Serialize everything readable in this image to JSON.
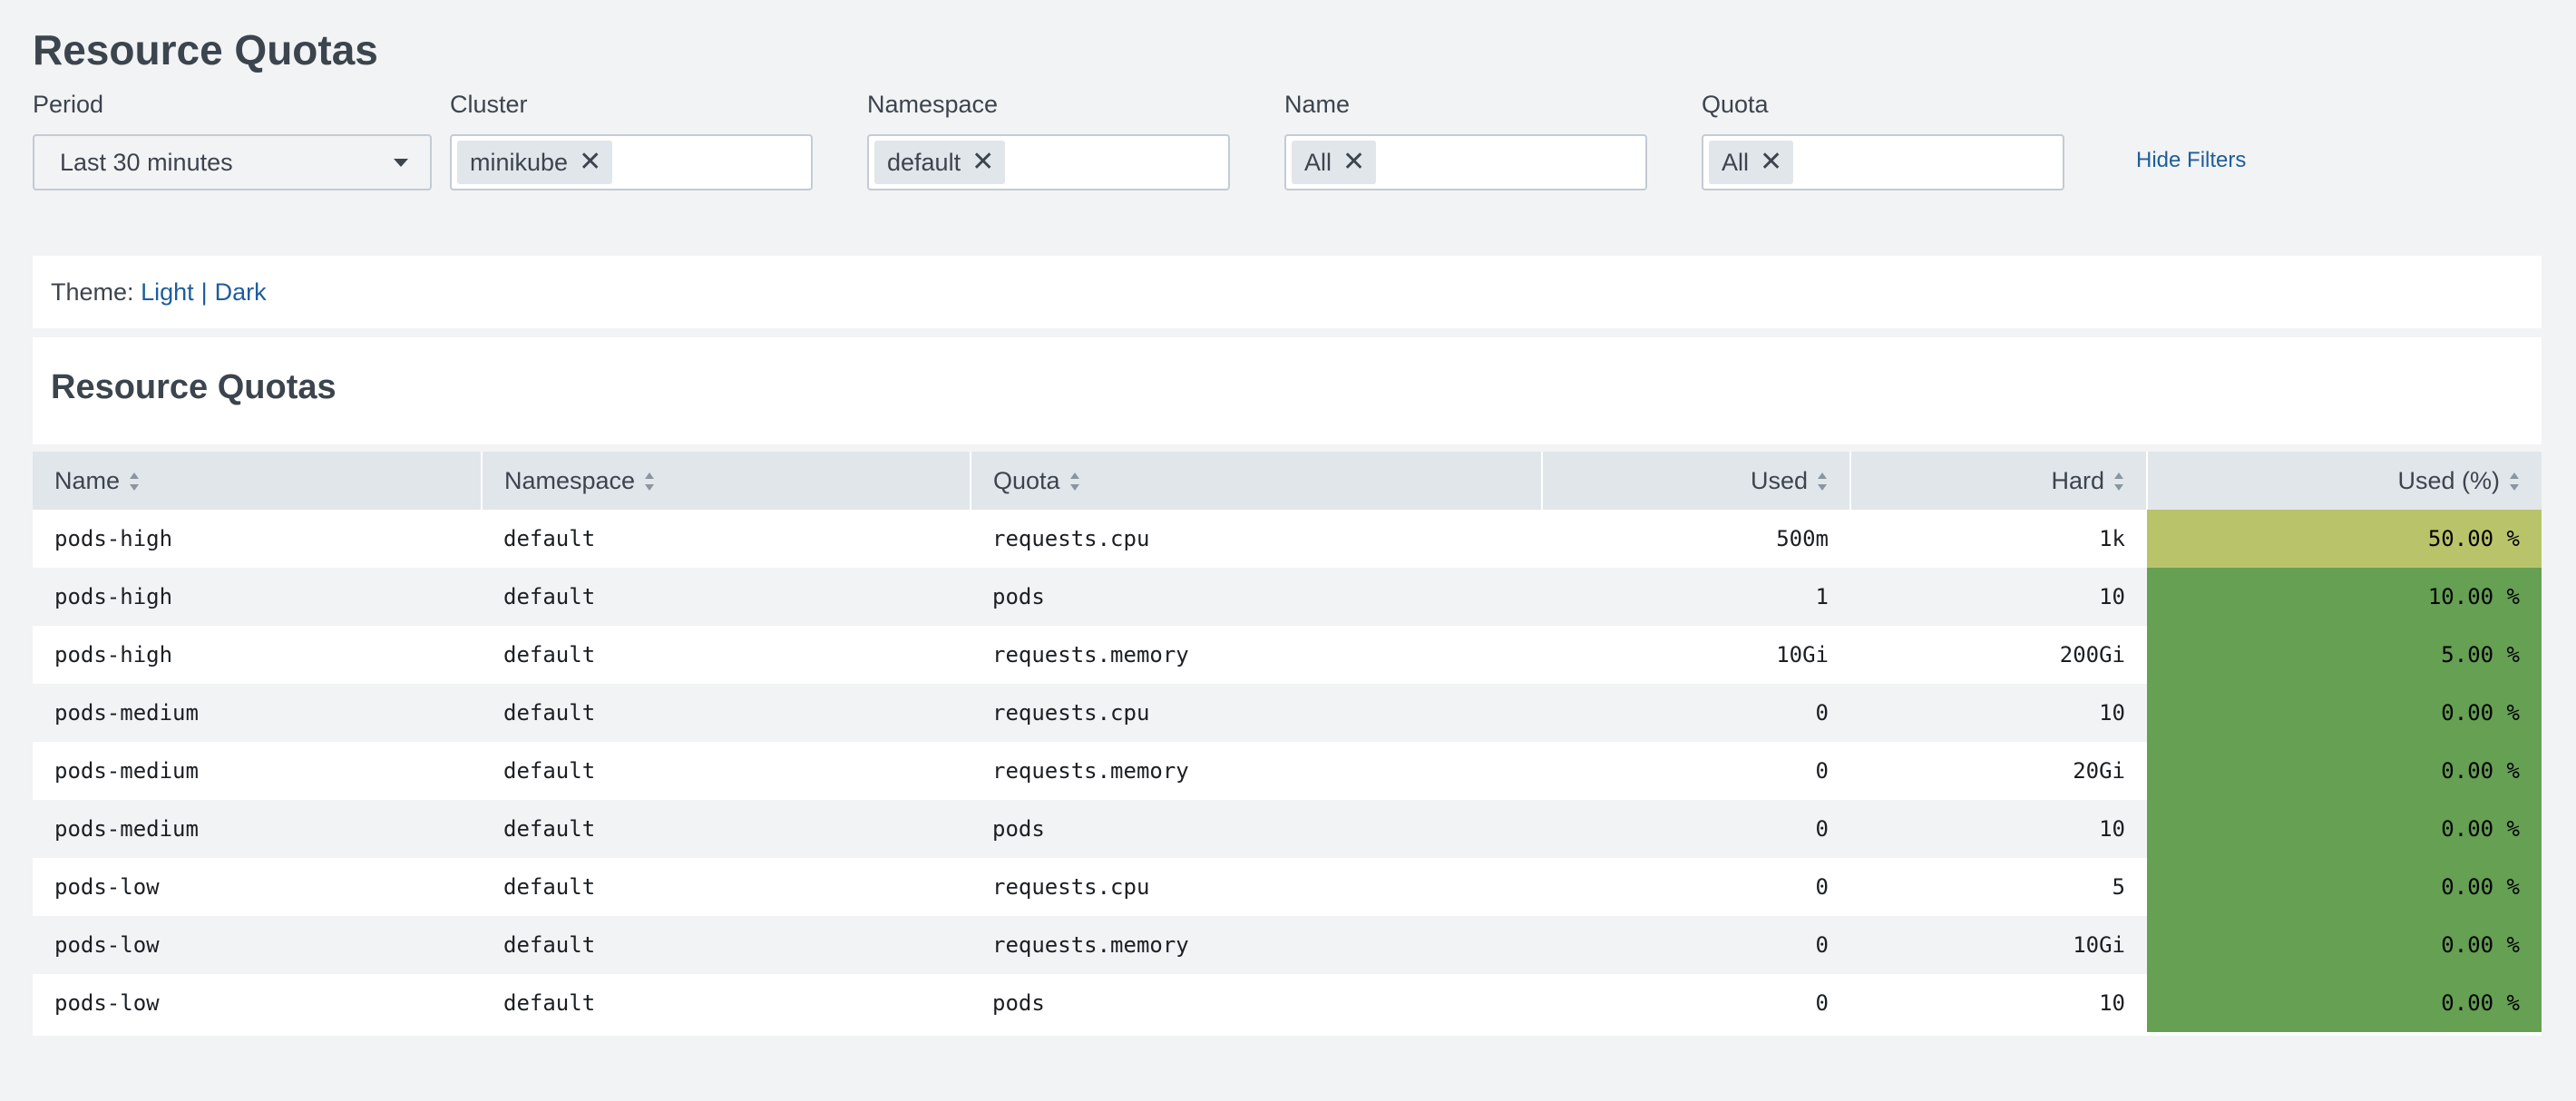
{
  "page": {
    "title": "Resource Quotas"
  },
  "filters": {
    "period": {
      "label": "Period",
      "value": "Last 30 minutes"
    },
    "cluster": {
      "label": "Cluster",
      "tokens": [
        "minikube"
      ]
    },
    "namespace": {
      "label": "Namespace",
      "tokens": [
        "default"
      ]
    },
    "name": {
      "label": "Name",
      "tokens": [
        "All"
      ]
    },
    "quota": {
      "label": "Quota",
      "tokens": [
        "All"
      ]
    },
    "hide_filters": "Hide Filters",
    "remove_glyph": "✕"
  },
  "theme": {
    "label": "Theme:",
    "light": "Light",
    "separator": "|",
    "dark": "Dark"
  },
  "panel": {
    "title": "Resource Quotas"
  },
  "table": {
    "columns": [
      "Name",
      "Namespace",
      "Quota",
      "Used",
      "Hard",
      "Used (%)"
    ],
    "rows": [
      [
        "pods-high",
        "default",
        "requests.cpu",
        "500m",
        "1k",
        "50.00 %"
      ],
      [
        "pods-high",
        "default",
        "pods",
        "1",
        "10",
        "10.00 %"
      ],
      [
        "pods-high",
        "default",
        "requests.memory",
        "10Gi",
        "200Gi",
        "5.00 %"
      ],
      [
        "pods-medium",
        "default",
        "requests.cpu",
        "0",
        "10",
        "0.00 %"
      ],
      [
        "pods-medium",
        "default",
        "requests.memory",
        "0",
        "20Gi",
        "0.00 %"
      ],
      [
        "pods-medium",
        "default",
        "pods",
        "0",
        "10",
        "0.00 %"
      ],
      [
        "pods-low",
        "default",
        "requests.cpu",
        "0",
        "5",
        "0.00 %"
      ],
      [
        "pods-low",
        "default",
        "requests.memory",
        "0",
        "10Gi",
        "0.00 %"
      ],
      [
        "pods-low",
        "default",
        "pods",
        "0",
        "10",
        "0.00 %"
      ]
    ],
    "used_pct_colors": [
      "#b9c46a",
      "#65a053",
      "#65a053",
      "#65a053",
      "#65a053",
      "#65a053",
      "#65a053",
      "#65a053",
      "#65a053"
    ]
  },
  "colors": {
    "accent_link": "#1e5d9c",
    "background": "#f2f3f5",
    "header_bg": "#e1e6eb"
  }
}
